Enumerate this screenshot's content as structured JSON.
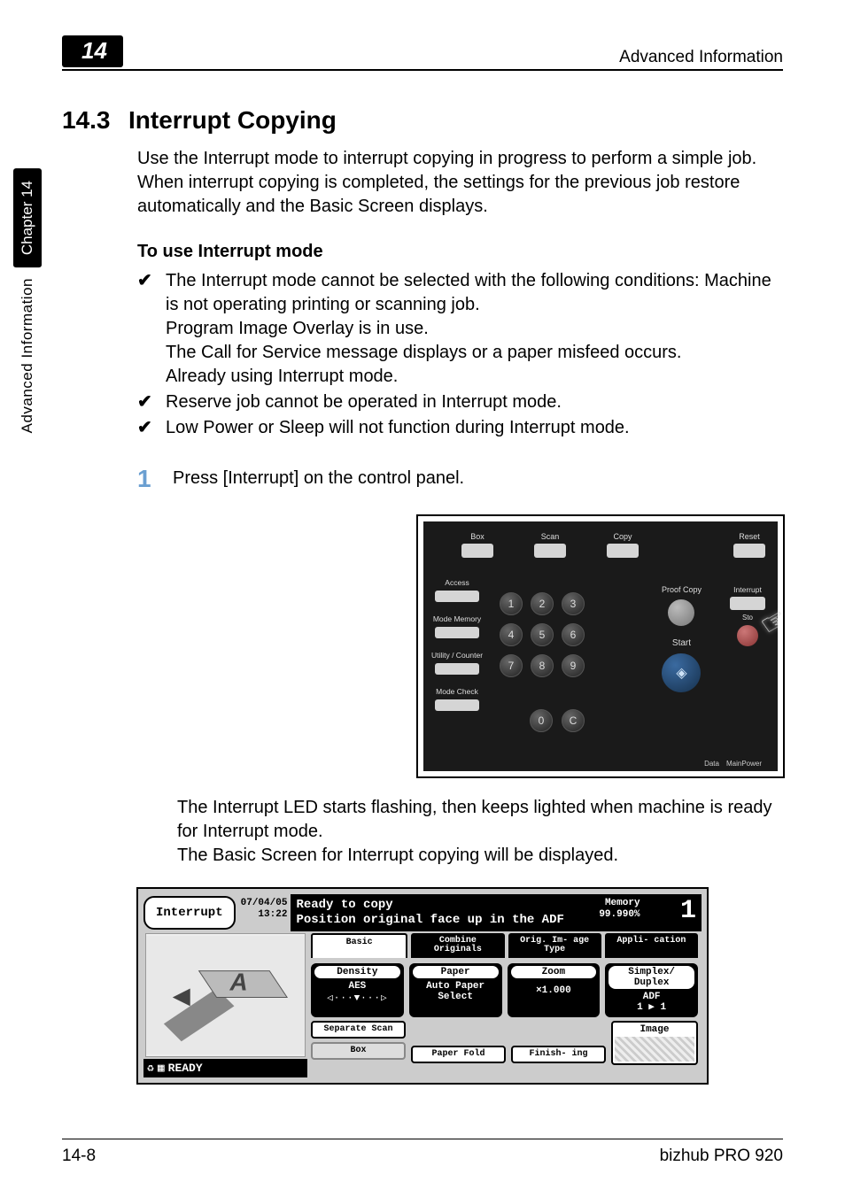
{
  "header": {
    "chapter_badge": "14",
    "right": "Advanced Information"
  },
  "sidetab": {
    "chapter": "Chapter 14",
    "label": "Advanced Information"
  },
  "section": {
    "num": "14.3",
    "title": "Interrupt Copying"
  },
  "intro": "Use the Interrupt mode to interrupt copying in progress to perform a simple job. When interrupt copying is completed, the settings for the previous job restore automatically and the Basic Screen displays.",
  "subhead": "To use Interrupt mode",
  "checks": [
    "The Interrupt mode cannot be selected with the following conditions: Machine is not operating printing or scanning job.\nProgram Image Overlay is in use.\nThe Call for Service message displays or a paper misfeed occurs.\nAlready using Interrupt mode.",
    "Reserve job cannot be operated in Interrupt mode.",
    "Low Power or Sleep will not function during Interrupt mode."
  ],
  "step1": {
    "num": "1",
    "text": "Press [Interrupt] on the control panel."
  },
  "panel": {
    "top": [
      "Box",
      "Scan",
      "Copy"
    ],
    "reset": "Reset",
    "left": [
      "Access",
      "Mode Memory",
      "Utility / Counter",
      "Mode Check"
    ],
    "keypad": [
      "1",
      "2",
      "3",
      "4",
      "5",
      "6",
      "7",
      "8",
      "9",
      "0",
      "C"
    ],
    "proof": "Proof Copy",
    "start": "Start",
    "interrupt": "Interrupt",
    "stop": "Sto",
    "status": [
      "Data",
      "MainPower"
    ]
  },
  "after": [
    "The Interrupt LED starts flashing, then keeps lighted when machine is ready for Interrupt mode.",
    "The Basic Screen for Interrupt copying will be displayed."
  ],
  "screen": {
    "tag": "Interrupt",
    "date": "07/04/05",
    "time": "13:22",
    "msg1": "Ready to copy",
    "msg2": "Position original face up in the ADF",
    "memory_label": "Memory",
    "memory_val": "99.990%",
    "copies": "1",
    "tabs": [
      "Basic",
      "Combine Originals",
      "Orig. Im- age Type",
      "Appli- cation"
    ],
    "settings": {
      "density": {
        "title": "Density",
        "val": "AES"
      },
      "paper": {
        "title": "Paper",
        "val": "Auto Paper Select"
      },
      "zoom": {
        "title": "Zoom",
        "val": "×1.000"
      },
      "duplex": {
        "title": "Simplex/ Duplex",
        "val1": "ADF",
        "val2": "1 ▶ 1"
      }
    },
    "bottom": {
      "separate": "Separate Scan",
      "box": "Box",
      "paperfold": "Paper Fold",
      "finishing": "Finish- ing",
      "image": "Image"
    },
    "ready_row": "READY"
  },
  "footer": {
    "left": "14-8",
    "right": "bizhub PRO 920"
  }
}
